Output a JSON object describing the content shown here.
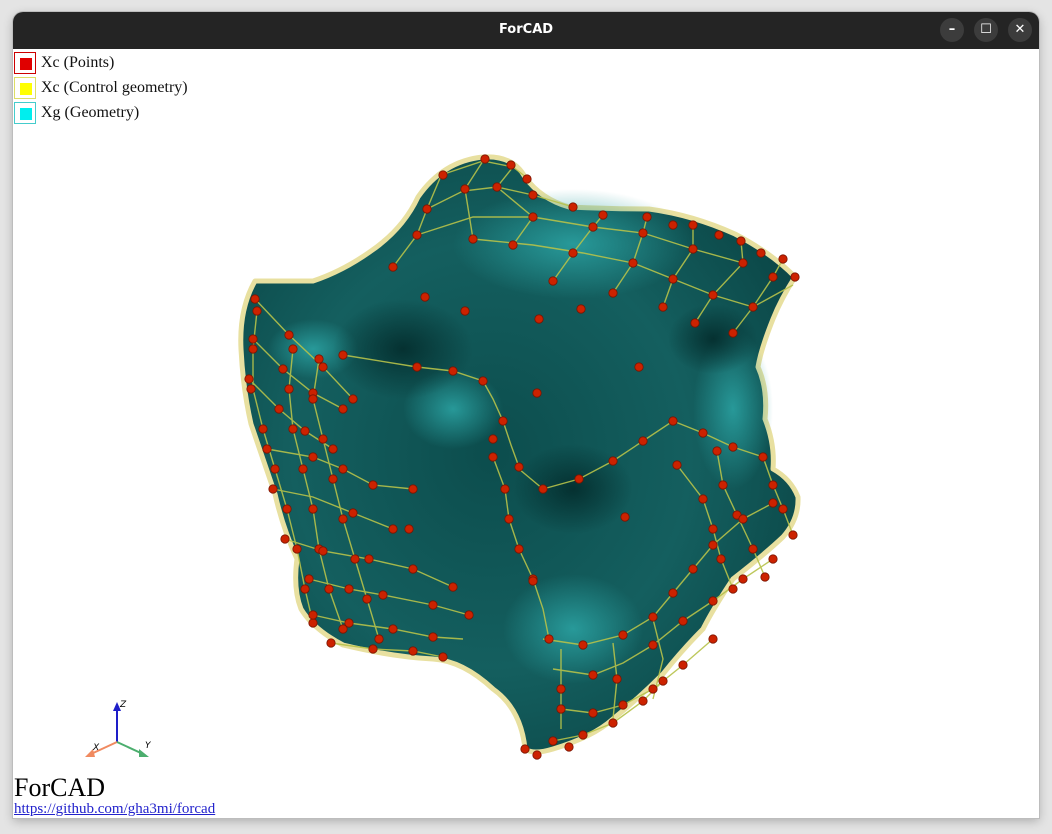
{
  "window": {
    "title": "ForCAD",
    "buttons": {
      "minimize": "–",
      "maximize": "☐",
      "close": "✕"
    }
  },
  "legend": [
    {
      "label": "Xc (Points)",
      "color": "#e00000",
      "border": "#cc0000"
    },
    {
      "label": "Xc (Control geometry)",
      "color": "#ffff00",
      "border": "#dddd66"
    },
    {
      "label": "Xg (Geometry)",
      "color": "#00eeee",
      "border": "#44cccc"
    }
  ],
  "axes": {
    "z": "Z",
    "x": "X",
    "y": "Y"
  },
  "footer": {
    "brand": "ForCAD",
    "link": "https://github.com/gha3mi/forcad"
  },
  "colors": {
    "surface": "#0f5757",
    "surface_highlight": "#1f9090",
    "control_lines": "#b6c24a",
    "control_points": "#cc2200",
    "axis_z": "#1e1ec8",
    "axis_x": "#f08a60",
    "axis_y": "#4cae6e"
  }
}
